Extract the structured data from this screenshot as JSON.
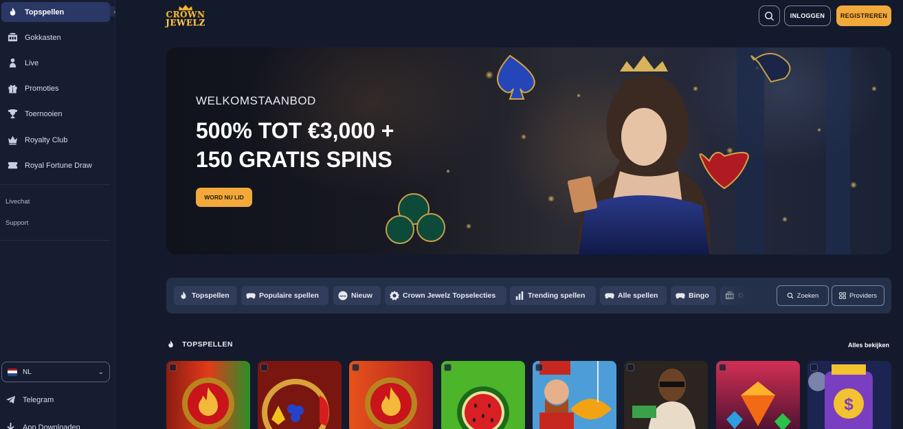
{
  "sidebar": {
    "items": [
      {
        "label": "Topspellen",
        "icon": "flame-icon",
        "active": true
      },
      {
        "label": "Gokkasten",
        "icon": "slot-machine-icon",
        "active": false
      },
      {
        "label": "Live",
        "icon": "dealer-icon",
        "active": false
      },
      {
        "label": "Promoties",
        "icon": "gift-icon",
        "active": false
      },
      {
        "label": "Toernooien",
        "icon": "trophy-icon",
        "active": false
      },
      {
        "label": "Royalty Club",
        "icon": "crown-icon",
        "active": false
      },
      {
        "label": "Royal Fortune Draw",
        "icon": "ticket-icon",
        "active": false
      }
    ],
    "links": [
      "Livechat",
      "Support"
    ],
    "language": {
      "code": "NL",
      "flag_colors": [
        "#ae1c28",
        "#ffffff",
        "#21468b"
      ]
    },
    "bottom": [
      {
        "label": "Telegram",
        "icon": "telegram-icon"
      },
      {
        "label": "App Downloaden",
        "icon": "download-icon"
      }
    ]
  },
  "header": {
    "logo": {
      "line1": "CROWN",
      "line2": "JEWELZ"
    },
    "search_icon": "search-icon",
    "login_label": "INLOGGEN",
    "register_label": "REGISTREREN"
  },
  "hero": {
    "kicker": "WELKOMSTAANBOD",
    "title_line1": "500% TOT €3,000 +",
    "title_line2": "150 GRATIS SPINS",
    "cta_label": "WORD NU LID"
  },
  "categories": [
    {
      "label": "Topspellen",
      "icon": "flame-icon"
    },
    {
      "label": "Populaire spellen",
      "icon": "gamepad-icon"
    },
    {
      "label": "Nieuw",
      "icon": "new-badge-icon"
    },
    {
      "label": "Crown Jewelz Topselecties",
      "icon": "badge-icon"
    },
    {
      "label": "Trending spellen",
      "icon": "bar-chart-icon"
    },
    {
      "label": "Alle spellen",
      "icon": "gamepad-icon"
    },
    {
      "label": "Bingo",
      "icon": "gamepad-icon"
    },
    {
      "label": "G",
      "icon": "slot-machine-icon"
    }
  ],
  "search_label": "Zoeken",
  "providers_label": "Providers",
  "section": {
    "title": "TOPSPELLEN",
    "see_all": "Alles bekijken"
  },
  "colors": {
    "accent": "#f2a93b",
    "sidebar_active": "#2b3866",
    "background": "#141a2c"
  }
}
